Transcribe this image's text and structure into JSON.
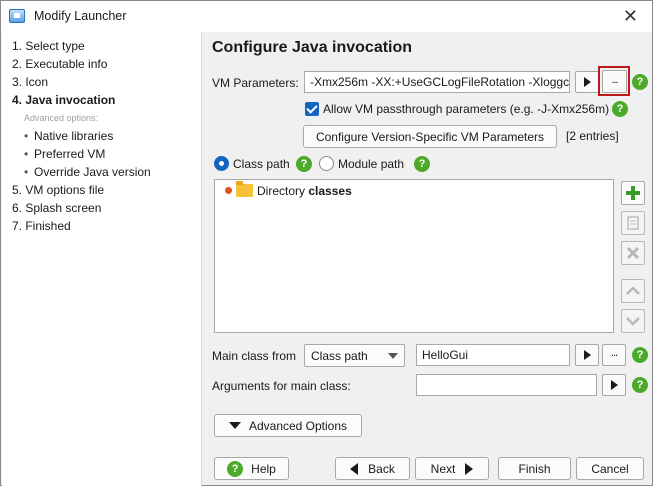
{
  "window": {
    "title": "Modify Launcher"
  },
  "sidebar": {
    "steps": [
      {
        "label": "1. Select type"
      },
      {
        "label": "2. Executable info"
      },
      {
        "label": "3. Icon"
      },
      {
        "label": "4. Java invocation"
      },
      {
        "label": "5. VM options file"
      },
      {
        "label": "6. Splash screen"
      },
      {
        "label": "7. Finished"
      }
    ],
    "advanced_label": "Advanced options:",
    "sub_items": [
      {
        "label": "Native libraries"
      },
      {
        "label": "Preferred VM"
      },
      {
        "label": "Override Java version"
      }
    ]
  },
  "main": {
    "heading": "Configure Java invocation",
    "vm_params_label": "VM Parameters:",
    "vm_params_value": "-Xmx256m -XX:+UseGCLogFileRotation -Xloggc",
    "passthrough_label": "Allow VM passthrough parameters (e.g. -J-Xmx256m)",
    "passthrough_checked": true,
    "configure_button": "Configure Version-Specific VM Parameters",
    "entries_text": "[2 entries]",
    "classpath_radio": "Class path",
    "modulepath_radio": "Module path",
    "selected_path_type": "Class path",
    "list_entry": {
      "prefix": "Directory",
      "name": "classes"
    },
    "main_class_from_label": "Main class from",
    "main_class_from_value": "Class path",
    "main_class_value": "HelloGui",
    "args_label": "Arguments for main class:",
    "args_value": "",
    "advanced_button": "Advanced Options"
  },
  "buttons": {
    "help": "Help",
    "back": "Back",
    "next": "Next",
    "finish": "Finish",
    "cancel": "Cancel"
  },
  "help_glyph": "?",
  "ellipsis_glyph": "...",
  "icons": [
    "app-icon",
    "close-icon",
    "play-icon",
    "more-icon",
    "help-icon",
    "folder-icon",
    "add-icon",
    "edit-icon",
    "delete-icon",
    "up-icon",
    "down-icon"
  ],
  "colors": {
    "accent": "#1565c0",
    "help_green": "#4caa2b",
    "highlight_red": "#c0161d",
    "status_dot": "#e0521b"
  }
}
